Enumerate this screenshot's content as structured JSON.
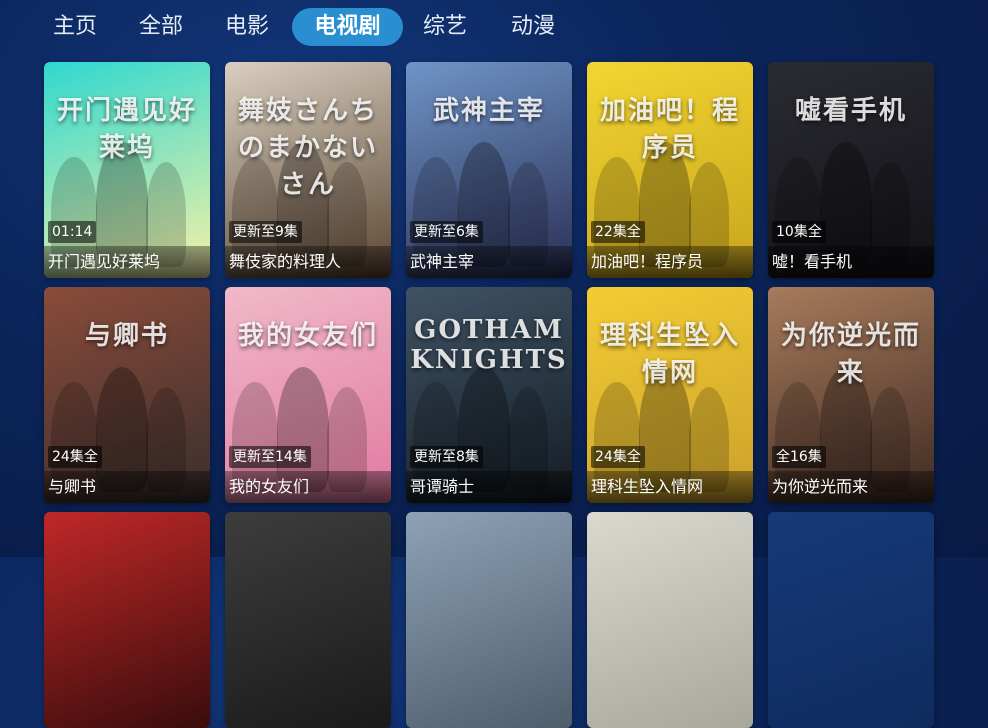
{
  "tabs": [
    {
      "label": "主页",
      "active": false
    },
    {
      "label": "全部",
      "active": false
    },
    {
      "label": "电影",
      "active": false
    },
    {
      "label": "电视剧",
      "active": true
    },
    {
      "label": "综艺",
      "active": false
    },
    {
      "label": "动漫",
      "active": false
    }
  ],
  "cards": [
    {
      "title": "开门遇见好莱坞",
      "badge": "01:14",
      "poster_text": "开门遇见好莱坞",
      "colors": [
        "#2fd8d0",
        "#f7f1a6"
      ]
    },
    {
      "title": "舞伎家的料理人",
      "badge": "更新至9集",
      "poster_text": "舞妓さんちのまかないさん",
      "colors": [
        "#d9cfc0",
        "#5b4632"
      ]
    },
    {
      "title": "武神主宰",
      "badge": "更新至6集",
      "poster_text": "武神主宰",
      "colors": [
        "#6f94c7",
        "#2a2f55"
      ]
    },
    {
      "title": "加油吧！程序员",
      "badge": "22集全",
      "poster_text": "加油吧！程序员",
      "colors": [
        "#f2d531",
        "#c9a51c"
      ]
    },
    {
      "title": "嘘！看手机",
      "badge": "10集全",
      "poster_text": "嘘看手机",
      "colors": [
        "#2b2b33",
        "#111116"
      ]
    },
    {
      "title": "与卿书",
      "badge": "24集全",
      "poster_text": "与卿书",
      "colors": [
        "#8a4b3a",
        "#3a2f2c"
      ]
    },
    {
      "title": "我的女友们",
      "badge": "更新至14集",
      "poster_text": "我的女友们",
      "colors": [
        "#f0b9c9",
        "#e27aa0"
      ]
    },
    {
      "title": "哥谭骑士",
      "badge": "更新至8集",
      "poster_text": "GOTHAM KNIGHTS",
      "colors": [
        "#3f5365",
        "#151c24"
      ]
    },
    {
      "title": "理科生坠入情网",
      "badge": "24集全",
      "poster_text": "理科生坠入情网",
      "colors": [
        "#f3cc34",
        "#cba12a"
      ]
    },
    {
      "title": "为你逆光而来",
      "badge": "全16集",
      "poster_text": "为你逆光而来",
      "colors": [
        "#a77b5c",
        "#3f2a22"
      ]
    },
    {
      "title": "",
      "badge": "",
      "poster_text": "",
      "colors": [
        "#c02828",
        "#3a0c0c"
      ]
    },
    {
      "title": "",
      "badge": "",
      "poster_text": "",
      "colors": [
        "#3d3d3d",
        "#1a1a1a"
      ]
    },
    {
      "title": "",
      "badge": "",
      "poster_text": "",
      "colors": [
        "#8ea2b6",
        "#4e5d6c"
      ]
    },
    {
      "title": "",
      "badge": "",
      "poster_text": "",
      "colors": [
        "#d9d9d0",
        "#a7a79c"
      ]
    },
    {
      "title": "",
      "badge": "",
      "poster_text": "",
      "colors": [
        "#163a78",
        "#0f2b5e"
      ]
    }
  ]
}
